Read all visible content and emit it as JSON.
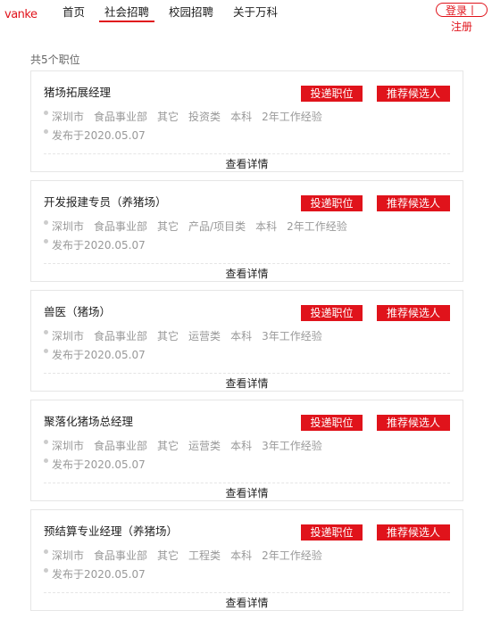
{
  "header": {
    "logo": "vanke",
    "nav": [
      "首页",
      "社会招聘",
      "校园招聘",
      "关于万科"
    ],
    "login": "登录丨",
    "register": "注册"
  },
  "colors": {
    "accent": "#e0131b"
  },
  "summary": "共5个职位",
  "jobs": [
    {
      "title": "猪场拓展经理",
      "apply": "投递职位",
      "recommend": "推荐候选人",
      "tags": [
        "深圳市",
        "食品事业部",
        "其它",
        "投资类",
        "本科",
        "2年工作经验"
      ],
      "date": "发布于2020.05.07",
      "detail": "查看详情"
    },
    {
      "title": "开发报建专员（养猪场）",
      "apply": "投递职位",
      "recommend": "推荐候选人",
      "tags": [
        "深圳市",
        "食品事业部",
        "其它",
        "产品/项目类",
        "本科",
        "2年工作经验"
      ],
      "date": "发布于2020.05.07",
      "detail": "查看详情"
    },
    {
      "title": "兽医（猪场）",
      "apply": "投递职位",
      "recommend": "推荐候选人",
      "tags": [
        "深圳市",
        "食品事业部",
        "其它",
        "运营类",
        "本科",
        "3年工作经验"
      ],
      "date": "发布于2020.05.07",
      "detail": "查看详情"
    },
    {
      "title": "聚落化猪场总经理",
      "apply": "投递职位",
      "recommend": "推荐候选人",
      "tags": [
        "深圳市",
        "食品事业部",
        "其它",
        "运营类",
        "本科",
        "3年工作经验"
      ],
      "date": "发布于2020.05.07",
      "detail": "查看详情"
    },
    {
      "title": "预结算专业经理（养猪场）",
      "apply": "投递职位",
      "recommend": "推荐候选人",
      "tags": [
        "深圳市",
        "食品事业部",
        "其它",
        "工程类",
        "本科",
        "2年工作经验"
      ],
      "date": "发布于2020.05.07",
      "detail": "查看详情"
    }
  ]
}
